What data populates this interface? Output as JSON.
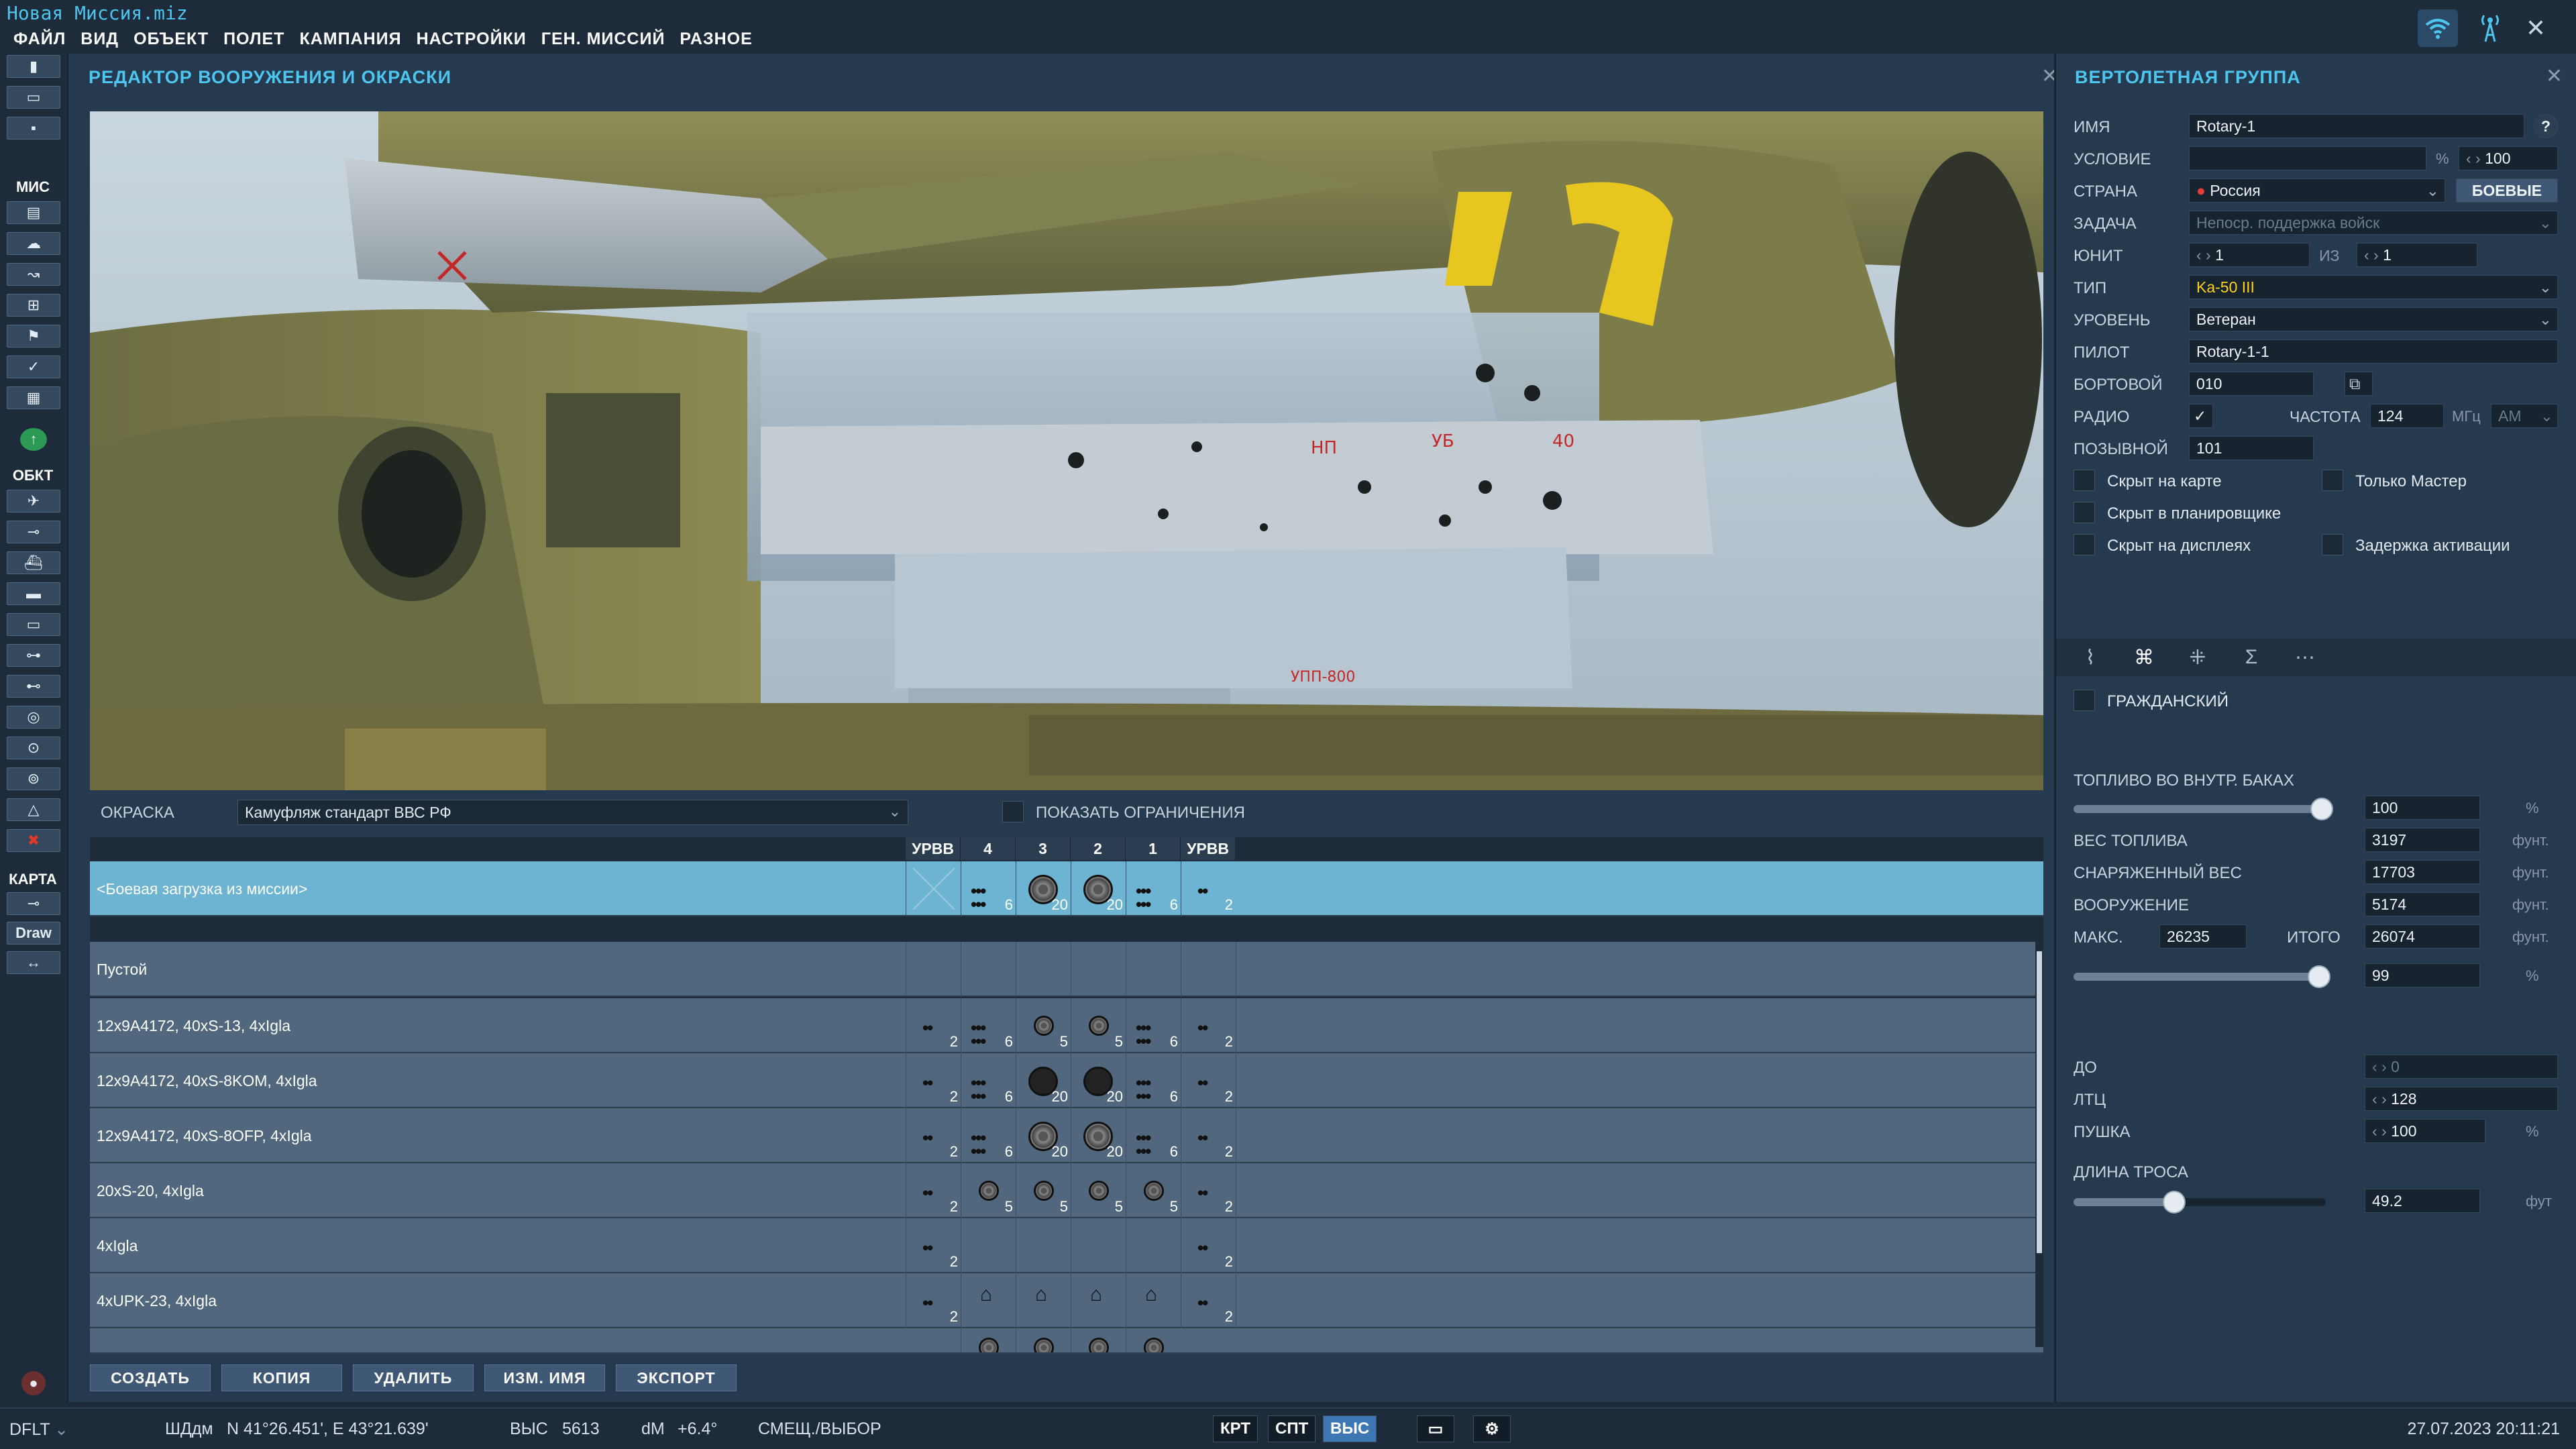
{
  "app": {
    "title": "Новая Миссия.miz"
  },
  "menu": [
    "ФАЙЛ",
    "ВИД",
    "ОБЪЕКТ",
    "ПОЛЕТ",
    "КАМПАНИЯ",
    "НАСТРОЙКИ",
    "ГЕН. МИССИЙ",
    "РАЗНОЕ"
  ],
  "toolbar": {
    "sections": {
      "mission": "МИС",
      "objects": "ОБКТ",
      "map": "КАРТА"
    },
    "draw_label": "Draw"
  },
  "editor": {
    "title": "РЕДАКТОР ВООРУЖЕНИЯ И ОКРАСКИ",
    "livery_label": "ОКРАСКА",
    "livery_value": "Камуфляж стандарт ВВС РФ",
    "show_limits_label": "ПОКАЗАТЬ ОГРАНИЧЕНИЯ",
    "pylon_headers": [
      "УРВВ",
      "4",
      "3",
      "2",
      "1",
      "УРВВ"
    ],
    "selected_row": {
      "label": "<Боевая загрузка из миссии>",
      "counts": [
        "",
        "6",
        "20",
        "20",
        "6",
        "2"
      ]
    },
    "rows": [
      {
        "label": "Пустой",
        "counts": [
          "",
          "",
          "",
          "",
          "",
          ""
        ]
      },
      {
        "label": "12x9A4172, 40xS-13, 4xIgla",
        "counts": [
          "2",
          "6",
          "5",
          "5",
          "6",
          "2"
        ]
      },
      {
        "label": "12x9A4172, 40xS-8KOM, 4xIgla",
        "counts": [
          "2",
          "6",
          "20",
          "20",
          "6",
          "2"
        ]
      },
      {
        "label": "12x9A4172, 40xS-8OFP, 4xIgla",
        "counts": [
          "2",
          "6",
          "20",
          "20",
          "6",
          "2"
        ]
      },
      {
        "label": "20xS-20, 4xIgla",
        "counts": [
          "2",
          "5",
          "5",
          "5",
          "5",
          "2"
        ]
      },
      {
        "label": "4xIgla",
        "counts": [
          "2",
          "",
          "",
          "",
          "",
          "2"
        ]
      },
      {
        "label": "4xUPK-23, 4xIgla",
        "counts": [
          "2",
          "",
          "",
          "",
          "",
          "2"
        ]
      }
    ],
    "buttons": [
      "СОЗДАТЬ",
      "КОПИЯ",
      "УДАЛИТЬ",
      "ИЗМ. ИМЯ",
      "ЭКСПОРТ"
    ]
  },
  "panel": {
    "title": "ВЕРТОЛЕТНАЯ ГРУППА",
    "name_label": "ИМЯ",
    "name_value": "Rotary-1",
    "help": "?",
    "condition_label": "УСЛОВИЕ",
    "condition_unit": "%",
    "condition_value": "100",
    "country_label": "СТРАНА",
    "country_value": "Россия",
    "combat_btn": "БОЕВЫЕ",
    "task_label": "ЗАДАЧА",
    "task_value": "Непоср. поддержка войск",
    "unit_label": "ЮНИТ",
    "unit_value": "1",
    "of_label": "ИЗ",
    "of_value": "1",
    "type_label": "ТИП",
    "type_value": "Ka-50 III",
    "level_label": "УРОВЕНЬ",
    "level_value": "Ветеран",
    "pilot_label": "ПИЛОТ",
    "pilot_value": "Rotary-1-1",
    "board_label": "БОРТОВОЙ",
    "board_value": "010",
    "radio_label": "РАДИО",
    "freq_label": "ЧАСТОТА",
    "freq_value": "124",
    "freq_unit": "МГц",
    "mod_value": "AM",
    "callsign_label": "ПОЗЫВНОЙ",
    "callsign_value": "101",
    "checks": {
      "hidden_map": "Скрыт на карте",
      "master_only": "Только Мастер",
      "hidden_planner": "Скрыт в планировщике",
      "hidden_display": "Скрыт на дисплеях",
      "late_activation": "Задержка активации"
    },
    "civil_label": "ГРАЖДАНСКИЙ",
    "fuel_internal_label": "ТОПЛИВО ВО ВНУТР. БАКАХ",
    "fuel_internal_value": "100",
    "fuel_internal_unit": "%",
    "fuel_fraction": 1.0,
    "fuel_weight_label": "ВЕС ТОПЛИВА",
    "fuel_weight_value": "3197",
    "empty_weight_label": "СНАРЯЖЕННЫЙ ВЕС",
    "empty_weight_value": "17703",
    "weapons_label": "ВООРУЖЕНИЕ",
    "weapons_value": "5174",
    "lb": "фунт.",
    "max_label": "МАКС.",
    "max_value": "26235",
    "total_label": "ИТОГО",
    "total_value": "26074",
    "total_pct": "99",
    "total_pct_unit": "%",
    "total_fraction": 0.99,
    "do_label": "ДО",
    "do_value": "0",
    "ltc_label": "ЛТЦ",
    "ltc_value": "128",
    "gun_label": "ПУШКА",
    "gun_value": "100",
    "gun_unit": "%",
    "rope_label": "ДЛИНА ТРОСА",
    "rope_value": "49.2",
    "rope_unit": "фут",
    "rope_fraction": 0.4
  },
  "status": {
    "profile": "DFLT",
    "coord_label": "ШДдм",
    "coords": "N 41°26.451', E 43°21.639'",
    "alt_label": "ВЫС",
    "alt_value": "5613",
    "dm_label": "dM",
    "dm_value": "+6.4°",
    "mode": "СМЕЩ./ВЫБОР",
    "btn_krt": "КРТ",
    "btn_spt": "СПТ",
    "btn_vys": "ВЫС",
    "datetime": "27.07.2023 20:11:21"
  }
}
